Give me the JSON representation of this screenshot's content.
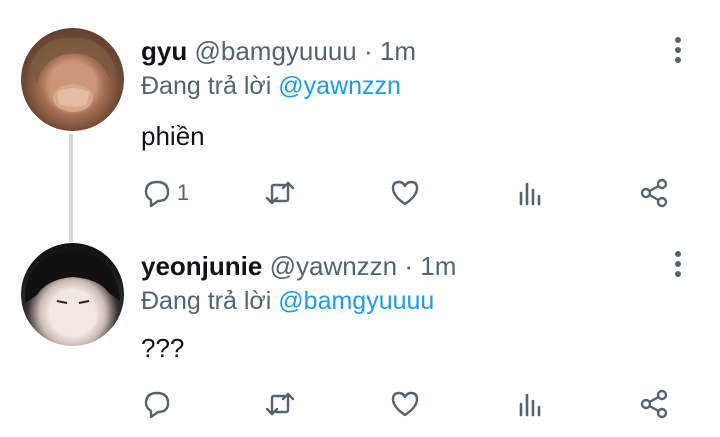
{
  "tweets": [
    {
      "name": "gyu",
      "handle": "@bamgyuuuu",
      "separator": "·",
      "time": "1m",
      "replying_prefix": "Đang trả lời",
      "replying_to": "@yawnzzn",
      "text": "phiền",
      "reply_count": "1",
      "icons": [
        "reply-icon",
        "retweet-icon",
        "like-icon",
        "stats-icon",
        "share-icon",
        "more-icon"
      ]
    },
    {
      "name": "yeonjunie",
      "handle": "@yawnzzn",
      "separator": "·",
      "time": "1m",
      "replying_prefix": "Đang trả lời",
      "replying_to": "@bamgyuuuu",
      "text": "???",
      "reply_count": "",
      "icons": [
        "reply-icon",
        "retweet-icon",
        "like-icon",
        "stats-icon",
        "share-icon",
        "more-icon"
      ]
    }
  ],
  "colors": {
    "text": "#0f1419",
    "muted": "#536471",
    "accent": "#1d9bf0",
    "thread_line": "#cfd9de"
  }
}
